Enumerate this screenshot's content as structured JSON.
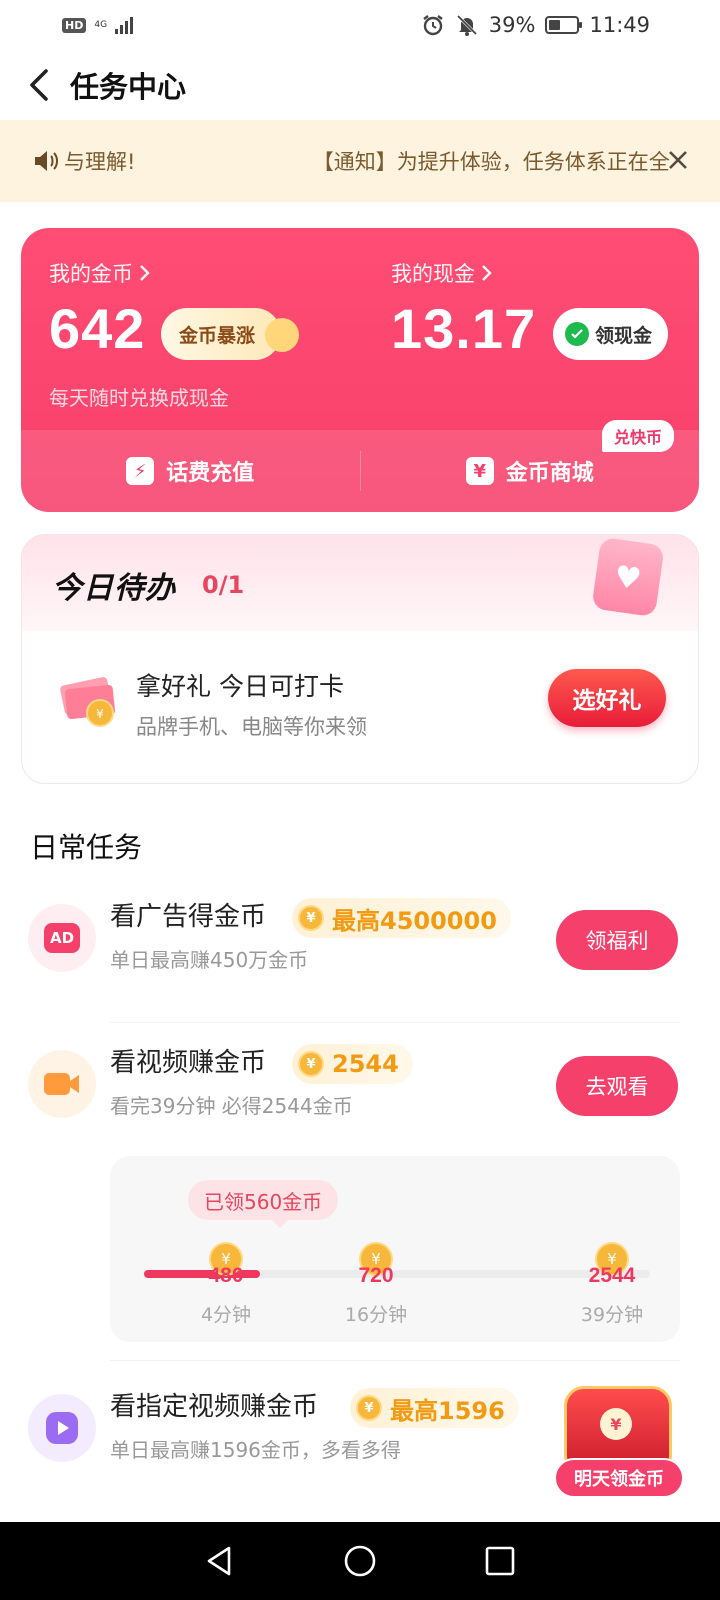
{
  "status_bar": {
    "hd": "HD",
    "network": "4G",
    "battery": "39%",
    "battery_level": 0.39,
    "time": "11:49"
  },
  "header": {
    "title": "任务中心"
  },
  "notice": {
    "text_tail": "与理解!",
    "text_head": "【通知】为提升体验，任务体系正在全"
  },
  "wallet": {
    "coins_label": "我的金币",
    "coins_value": "642",
    "surge_label": "金币暴涨",
    "coins_hint": "每天随时兑换成现金",
    "cash_label": "我的现金",
    "cash_value": "13.17",
    "cash_button": "领现金",
    "recharge_label": "话费充值",
    "mall_label": "金币商城",
    "mall_badge": "兑快币"
  },
  "todo": {
    "title": "今日待办",
    "count": "0/1",
    "item_title": "拿好礼 今日可打卡",
    "item_sub": "品牌手机、电脑等你来领",
    "button": "选好礼"
  },
  "daily": {
    "section_title": "日常任务",
    "tasks": [
      {
        "title": "看广告得金币",
        "reward": "最高4500000",
        "sub": "单日最高赚450万金币",
        "button": "领福利",
        "icon": "ad-icon",
        "icon_text": "AD"
      },
      {
        "title": "看视频赚金币",
        "reward": "2544",
        "sub": "看完39分钟 必得2544金币",
        "button": "去观看",
        "icon": "video-camera-icon"
      },
      {
        "title": "看指定视频赚金币",
        "reward": "最高1596",
        "sub": "单日最高赚1596金币，多看多得",
        "icon": "play-icon"
      }
    ],
    "progress": {
      "claimed": "已领560金币",
      "fill_fraction": 0.23,
      "milestones": [
        {
          "value": "480",
          "time": "4分钟"
        },
        {
          "value": "720",
          "time": "16分钟"
        },
        {
          "value": "2544",
          "time": "39分钟"
        }
      ]
    },
    "chest_label": "明天领金币"
  },
  "colors": {
    "accent": "#f5406b",
    "notice_bg": "#fdf3df",
    "gold": "#f29a12"
  }
}
